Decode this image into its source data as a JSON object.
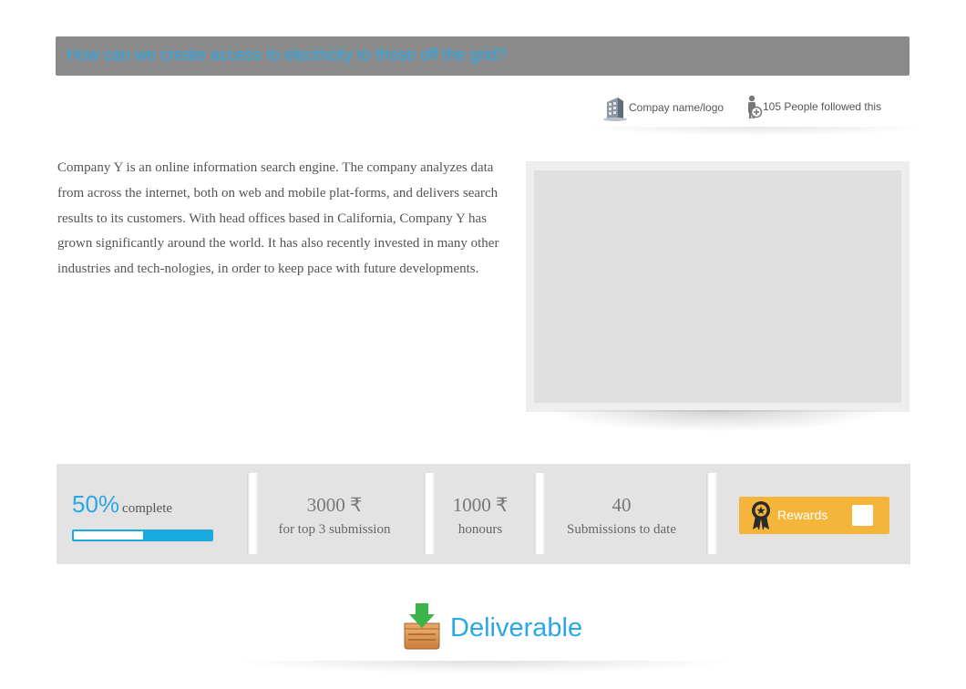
{
  "header": {
    "question": "How can we create access to electricity to those off the grid?"
  },
  "meta": {
    "company_label": "Compay name/logo",
    "followers_label": "105 People  followed this",
    "company_icon": "building-icon",
    "followers_icon": "person-add-icon"
  },
  "description": "Company Y is an online information search engine.  The company analyzes data from across the internet, both on web and mobile plat-forms, and delivers search results to its customers.  With head offices based in California, Company Y has grown significantly around the world.  It has also recently invested in many other industries and tech-nologies, in order to keep pace with future developments.",
  "stats": {
    "progress": {
      "value_text": "50%",
      "label": "complete",
      "fraction": 0.5
    },
    "prize": {
      "value": "3000 ₹",
      "label": "for  top 3 submission"
    },
    "honours": {
      "value": "1000 ₹",
      "label": "honours"
    },
    "submissions": {
      "value": "40",
      "label": "Submissions to date"
    },
    "rewards": {
      "label": "Rewards",
      "icon": "award-ribbon-icon"
    }
  },
  "deliverable": {
    "label": "Deliverable",
    "icon": "download-box-icon"
  },
  "colors": {
    "accent": "#2aa8e6",
    "title_bar": "#8a8a8a",
    "rewards": "#f5b53a",
    "stats_bg": "#e3e3e3"
  }
}
